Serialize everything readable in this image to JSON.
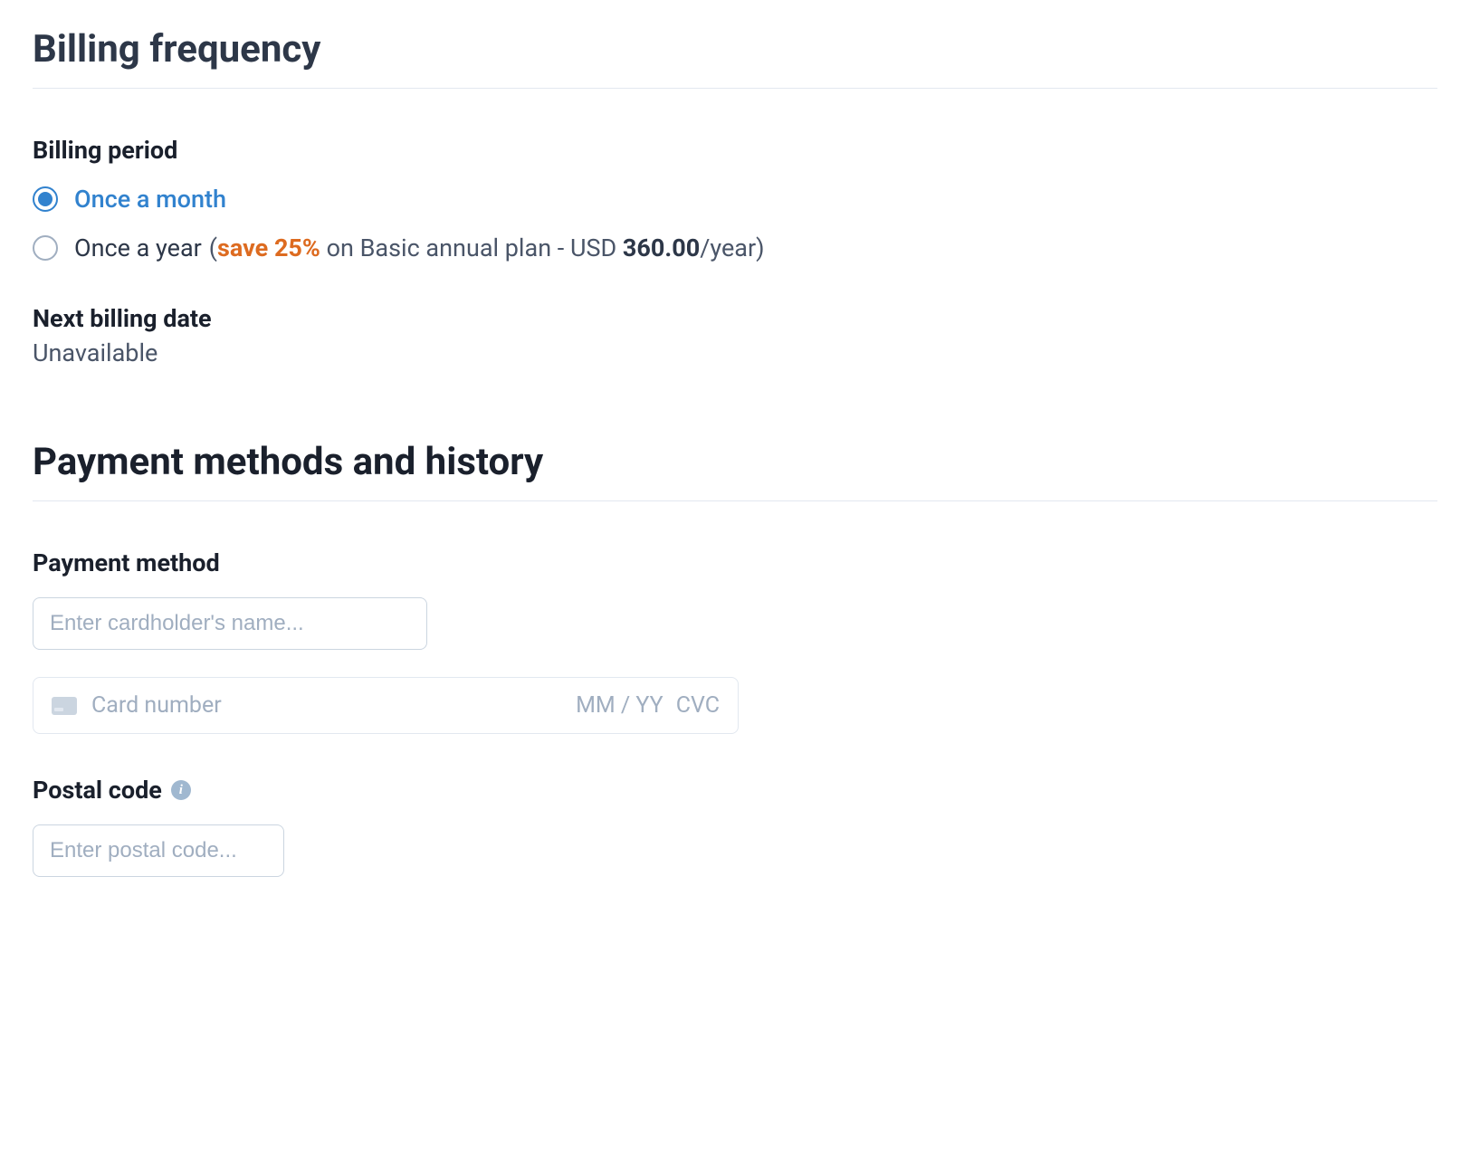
{
  "billingFrequency": {
    "heading": "Billing frequency",
    "billingPeriod": {
      "label": "Billing period",
      "options": {
        "monthly": {
          "label": "Once a month",
          "selected": true
        },
        "yearly": {
          "label": "Once a year",
          "savingsPrefix": "(",
          "savingsHighlight": "save 25%",
          "savingsMiddle": " on Basic annual plan - USD ",
          "price": "360.00",
          "savingsSuffix": "/year)"
        }
      }
    },
    "nextBilling": {
      "label": "Next billing date",
      "value": "Unavailable"
    }
  },
  "paymentMethods": {
    "heading": "Payment methods and history",
    "paymentMethod": {
      "label": "Payment method",
      "cardholderPlaceholder": "Enter cardholder's name...",
      "cardNumberPlaceholder": "Card number",
      "expiryPlaceholder": "MM / YY",
      "cvcPlaceholder": "CVC"
    },
    "postalCode": {
      "label": "Postal code",
      "placeholder": "Enter postal code..."
    }
  }
}
